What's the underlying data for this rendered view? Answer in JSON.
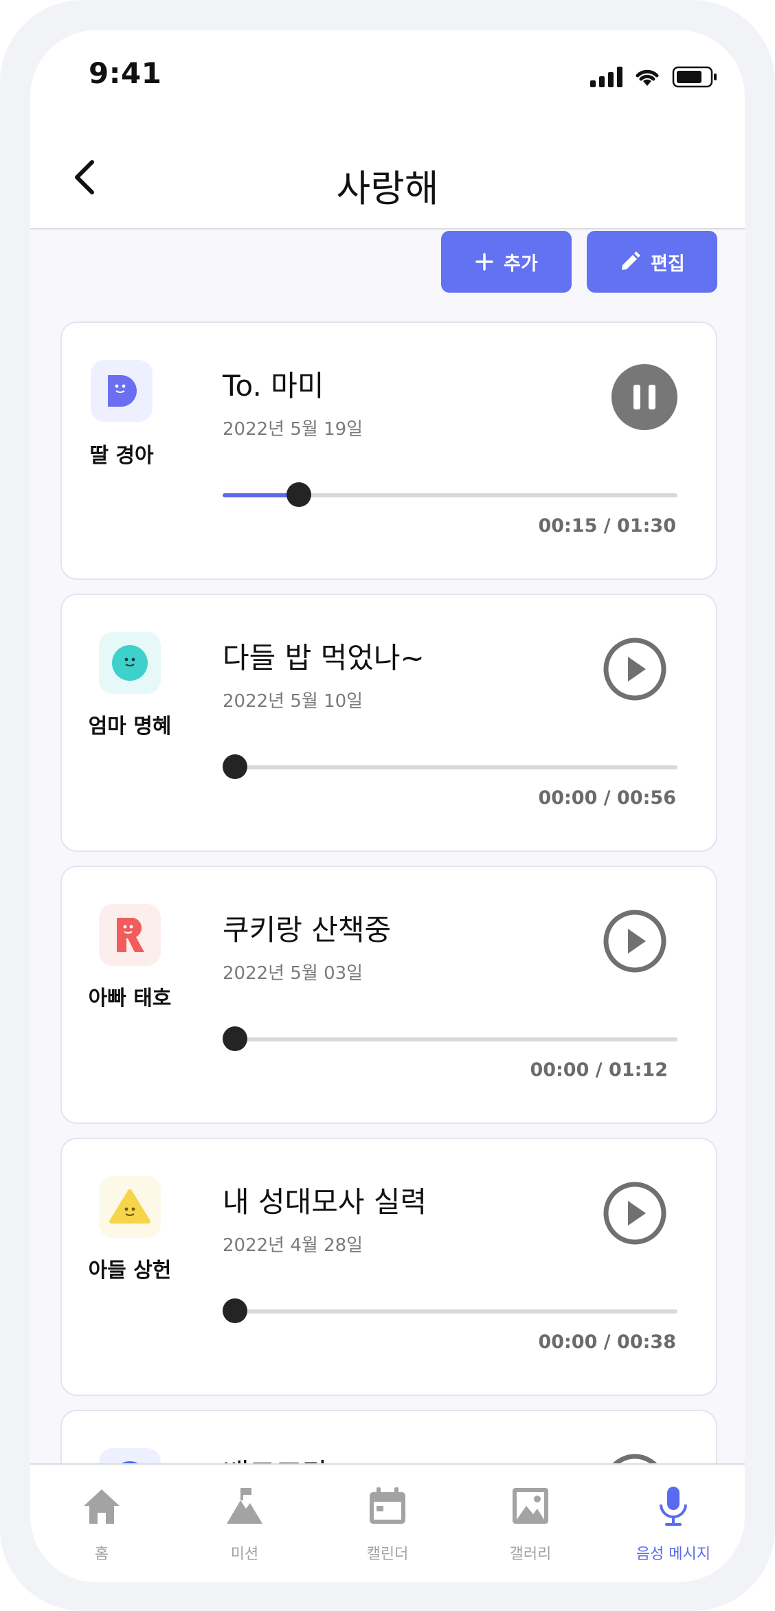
{
  "status_bar": {
    "time": "9:41"
  },
  "header": {
    "title": "사랑해"
  },
  "actions": {
    "add_label": "추가",
    "edit_label": "편집"
  },
  "messages": [
    {
      "sender": "딸 경아",
      "title": "To. 마미",
      "date": "2022년 5월 19일",
      "time": "00:15 / 01:30",
      "progress": 0.167,
      "state": "playing",
      "avatar_color": "#6b6ef0",
      "avatar_bg": "#eef0ff",
      "avatar_icon": "d-face-icon"
    },
    {
      "sender": "엄마 명혜",
      "title": "다들 밥 먹었나~",
      "date": "2022년 5월 10일",
      "time": "00:00 / 00:56",
      "progress": 0,
      "state": "paused",
      "avatar_color": "#3ed1cc",
      "avatar_bg": "#e7f8f8",
      "avatar_icon": "circle-face-icon"
    },
    {
      "sender": "아빠 태호",
      "title": "쿠키랑 산책중",
      "date": "2022년 5월 03일",
      "time": "00:00 / 01:12",
      "progress": 0,
      "state": "paused",
      "avatar_color": "#f25c5c",
      "avatar_bg": "#fdeeee",
      "avatar_icon": "r-face-icon"
    },
    {
      "sender": "아들 상헌",
      "title": "내 성대모사 실력",
      "date": "2022년 4월 28일",
      "time": "00:00 / 00:38",
      "progress": 0,
      "state": "paused",
      "avatar_color": "#f7d54a",
      "avatar_bg": "#fdf9e8",
      "avatar_icon": "triangle-face-icon"
    },
    {
      "sender": "",
      "title": "배고프다",
      "date": "",
      "time": "",
      "progress": 0,
      "state": "paused",
      "avatar_color": "#4b6ef0",
      "avatar_bg": "#eef0ff",
      "avatar_icon": "circle-face-icon"
    }
  ],
  "tabbar": {
    "items": [
      {
        "label": "홈",
        "icon": "home-icon"
      },
      {
        "label": "미션",
        "icon": "mountain-flag-icon"
      },
      {
        "label": "캘린더",
        "icon": "calendar-icon"
      },
      {
        "label": "갤러리",
        "icon": "gallery-icon"
      },
      {
        "label": "음성 메시지",
        "icon": "microphone-icon"
      }
    ],
    "active_index": 4
  },
  "colors": {
    "accent": "#5a6bef",
    "button": "#6272f0",
    "background": "#f7f7fc"
  }
}
